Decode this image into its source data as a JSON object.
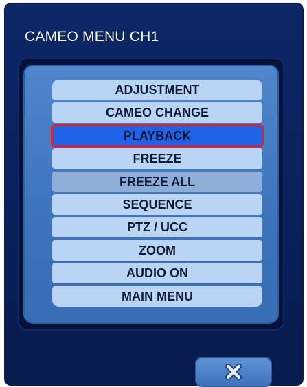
{
  "dialog": {
    "title": "CAMEO MENU CH1"
  },
  "menu": {
    "items": [
      {
        "label": "ADJUSTMENT",
        "state": "normal"
      },
      {
        "label": "CAMEO CHANGE",
        "state": "normal"
      },
      {
        "label": "PLAYBACK",
        "state": "selected"
      },
      {
        "label": "FREEZE",
        "state": "normal"
      },
      {
        "label": "FREEZE ALL",
        "state": "disabled"
      },
      {
        "label": "SEQUENCE",
        "state": "normal"
      },
      {
        "label": "PTZ / UCC",
        "state": "normal"
      },
      {
        "label": "ZOOM",
        "state": "normal"
      },
      {
        "label": "AUDIO ON",
        "state": "normal"
      },
      {
        "label": "MAIN MENU",
        "state": "normal"
      }
    ]
  },
  "close_button": {
    "icon": "close-icon"
  },
  "colors": {
    "dialog_bg": "#0b2260",
    "panel_bg": "#3c73bb",
    "item_bg": "#b9d5f3",
    "item_selected_bg": "#1f64e8",
    "item_disabled_bg": "#8eaed7",
    "selection_outline": "#e0202a"
  }
}
